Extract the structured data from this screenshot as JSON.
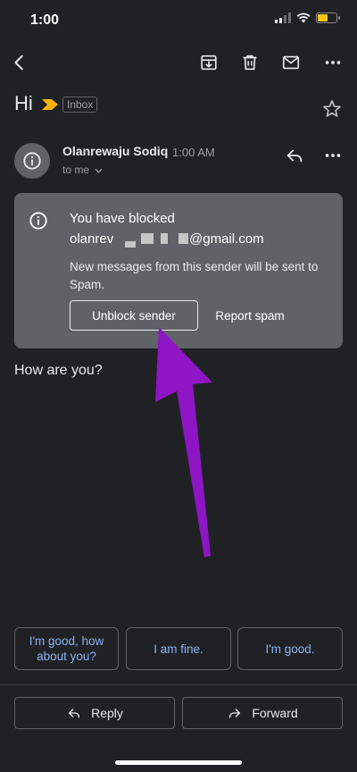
{
  "status_bar": {
    "time": "1:00"
  },
  "email": {
    "subject": "Hi",
    "label": "Inbox",
    "sender_name": "Olanrewaju Sodiq",
    "sent_time": "1:00 AM",
    "recipient": "to me",
    "body": "How are you?"
  },
  "blocked_notice": {
    "title": "You have blocked",
    "email_visible_prefix": "olanrev",
    "email_visible_suffix": "@gmail.com",
    "description": "New messages from this sender will be sent to Spam.",
    "unblock_label": "Unblock sender",
    "report_label": "Report spam"
  },
  "smart_replies": [
    "I'm good, how about you?",
    "I am fine.",
    "I'm good."
  ],
  "actions": {
    "reply_label": "Reply",
    "forward_label": "Forward"
  },
  "icons": {
    "toolbar": [
      "back-icon",
      "archive-icon",
      "delete-icon",
      "mark-unread-icon",
      "more-icon"
    ],
    "important_marker_color": "#f4b400",
    "annotation_arrow_color": "#8e16c4"
  }
}
